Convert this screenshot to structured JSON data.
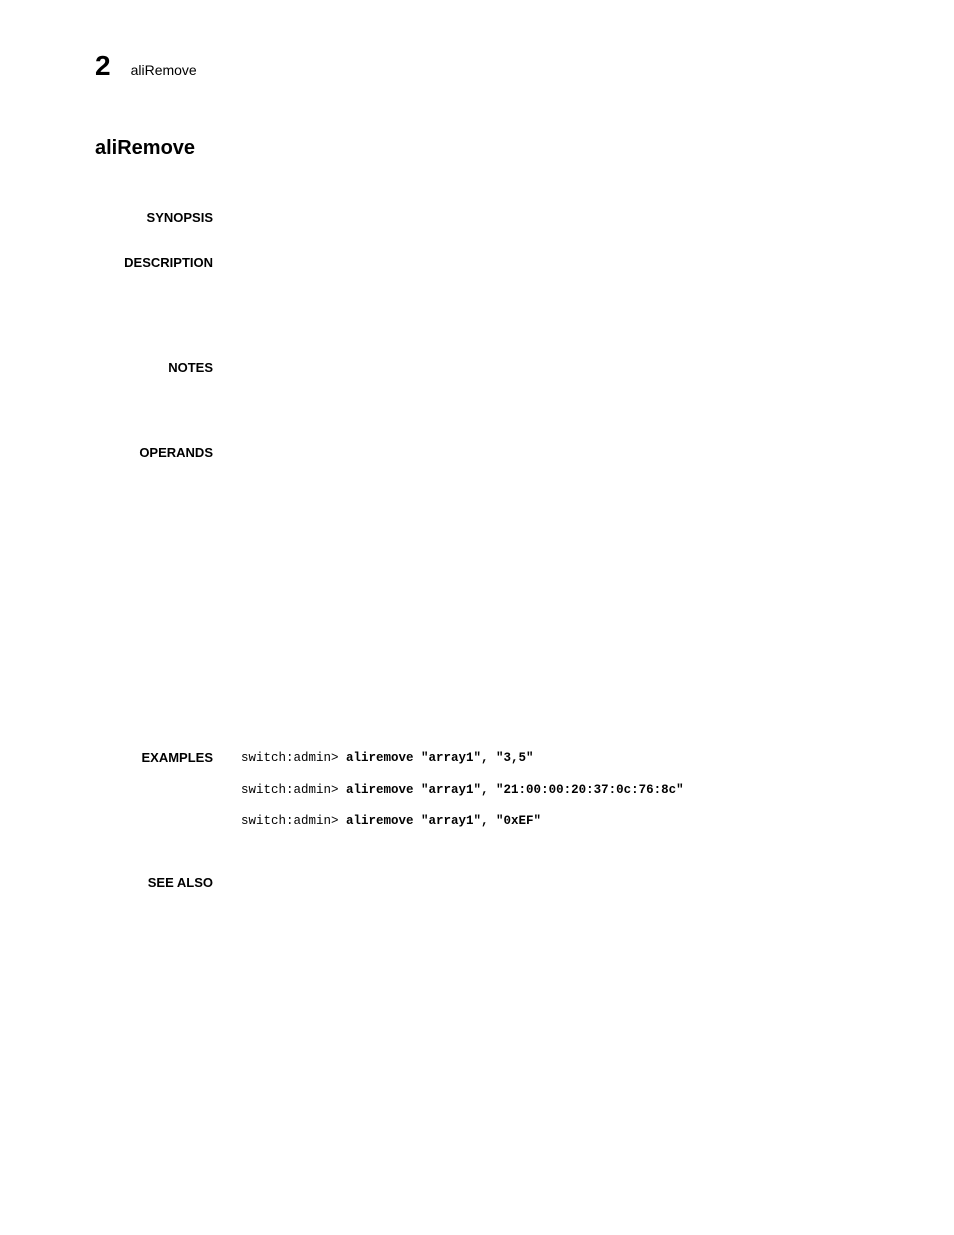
{
  "header": {
    "number": "2",
    "text": "aliRemove"
  },
  "title": "aliRemove",
  "sections": {
    "synopsis": {
      "label": "SYNOPSIS"
    },
    "description": {
      "label": "DESCRIPTION"
    },
    "notes": {
      "label": "NOTES"
    },
    "operands": {
      "label": "OPERANDS"
    },
    "examples": {
      "label": "EXAMPLES",
      "lines": [
        {
          "prompt": "switch:admin> ",
          "cmd": "aliremove \"array1\", \"3,5\""
        },
        {
          "prompt": "switch:admin> ",
          "cmd": "aliremove \"array1\", \"21:00:00:20:37:0c:76:8c\""
        },
        {
          "prompt": "switch:admin> ",
          "cmd": "aliremove \"array1\", \"0xEF\""
        }
      ]
    },
    "seealso": {
      "label": "SEE ALSO"
    }
  }
}
